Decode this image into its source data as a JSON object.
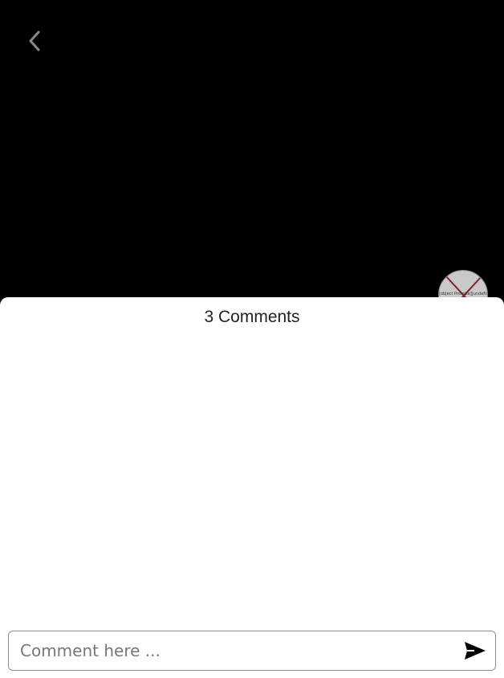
{
  "header": {
    "back_icon": "chevron-left-icon"
  },
  "media": {
    "avatar_alt": "[object Promise][undefined]"
  },
  "comments_panel": {
    "title": "3 Comments",
    "comments": []
  },
  "composer": {
    "placeholder": "Comment here ...",
    "value": "",
    "send_icon": "send-icon"
  },
  "colors": {
    "background": "#000000",
    "sheet": "#ffffff",
    "icon_gray": "#8a8a8a",
    "send_icon": "#000000",
    "avatar_cross": "#7a1f2b"
  }
}
